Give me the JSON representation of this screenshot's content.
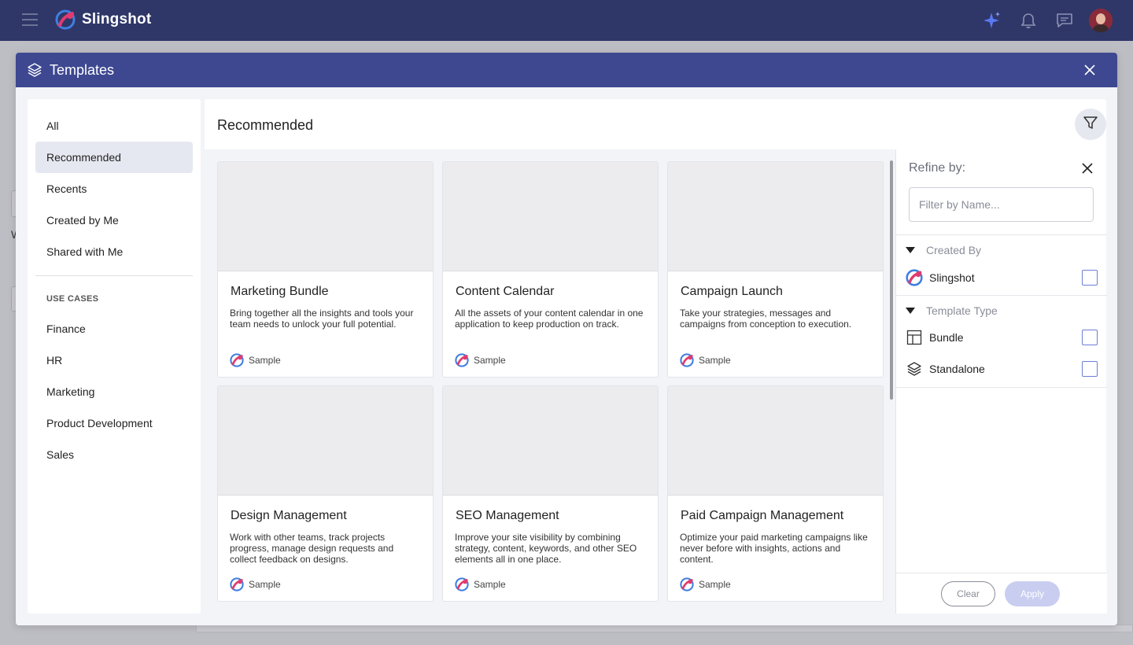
{
  "app": {
    "name": "Slingshot"
  },
  "topbar": {
    "icons": [
      "menu-icon",
      "sparkle-icon",
      "bell-icon",
      "chat-icon",
      "avatar"
    ]
  },
  "background": {
    "fragment_text": "W"
  },
  "modal": {
    "title": "Templates",
    "close_icon": "close-icon"
  },
  "left_nav": {
    "items": [
      {
        "label": "All",
        "active": false
      },
      {
        "label": "Recommended",
        "active": true
      },
      {
        "label": "Recents",
        "active": false
      },
      {
        "label": "Created by Me",
        "active": false
      },
      {
        "label": "Shared with Me",
        "active": false
      }
    ],
    "section_title": "USE CASES",
    "use_cases": [
      {
        "label": "Finance"
      },
      {
        "label": "HR"
      },
      {
        "label": "Marketing"
      },
      {
        "label": "Product Development"
      },
      {
        "label": "Sales"
      }
    ]
  },
  "main": {
    "title": "Recommended",
    "filter_icon": "filter-icon"
  },
  "cards": [
    {
      "title": "Marketing Bundle",
      "description": "Bring together all the insights and tools your team needs to unlock your full potential.",
      "tag": "Sample"
    },
    {
      "title": "Content Calendar",
      "description": "All the assets of your content calendar in one application to keep production on track.",
      "tag": "Sample"
    },
    {
      "title": "Campaign Launch",
      "description": "Take your strategies, messages and campaigns from conception to execution.",
      "tag": "Sample"
    },
    {
      "title": "Design Management",
      "description": "Work with other teams, track projects progress, manage design requests and collect feedback on designs.",
      "tag": "Sample"
    },
    {
      "title": "SEO Management",
      "description": "Improve your site visibility by combining strategy, content, keywords, and other SEO elements all in one place.",
      "tag": "Sample"
    },
    {
      "title": "Paid Campaign Management",
      "description": "Optimize your paid marketing campaigns like never before with insights, actions and content.",
      "tag": "Sample"
    }
  ],
  "refine": {
    "title": "Refine by:",
    "filter_placeholder": "Filter by Name...",
    "created_by": {
      "label": "Created By",
      "options": [
        {
          "label": "Slingshot",
          "checked": false
        }
      ]
    },
    "template_type": {
      "label": "Template Type",
      "options": [
        {
          "label": "Bundle",
          "icon": "bundle-icon",
          "checked": false
        },
        {
          "label": "Standalone",
          "icon": "layers-icon",
          "checked": false
        }
      ]
    },
    "clear_label": "Clear",
    "apply_label": "Apply"
  },
  "colors": {
    "topbar": "#2f3768",
    "modal_header": "#3d4891",
    "accent": "#6d7fd6",
    "apply_disabled": "#c9cdf0"
  }
}
